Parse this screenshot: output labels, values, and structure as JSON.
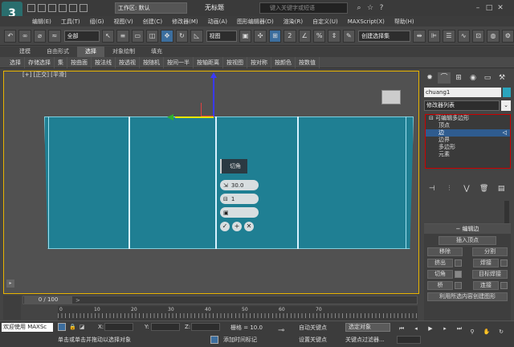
{
  "title_bar": {
    "workspace_label": "工作区: 默认",
    "doc_title": "无标题",
    "search_placeholder": "键入关键字或短语"
  },
  "menu": [
    "编辑(E)",
    "工具(T)",
    "组(G)",
    "视图(V)",
    "创建(C)",
    "修改器(M)",
    "动画(A)",
    "图形编辑器(D)",
    "渲染(R)",
    "自定义(U)",
    "MAXScript(X)",
    "帮助(H)"
  ],
  "toolbar": {
    "selection_filter": "全部",
    "ref_coord": "视图",
    "named_selection": "创建选择集"
  },
  "ribbon": {
    "tabs": [
      "建模",
      "自由形式",
      "选择",
      "对象绘制",
      "填充"
    ],
    "active_tab": "选择",
    "commands": [
      "选择",
      "存储选择",
      "集",
      "按曲面",
      "按法线",
      "按透视",
      "按随机",
      "按间一半",
      "按轴距离",
      "按视图",
      "按对称",
      "按颜色",
      "按数值"
    ]
  },
  "viewport": {
    "label": "[+] [正交] [平滑]",
    "caddy": {
      "title": "切角",
      "amount": "30.0",
      "segments": "1",
      "rows": [
        "30.0",
        "1",
        ""
      ],
      "ok": "✓",
      "apply": "+",
      "cancel": "✕"
    }
  },
  "command_panel": {
    "object_name": "chuang1",
    "object_color": "#2aa5bd",
    "modifier_list": "修改器列表",
    "stack": [
      {
        "label": "可编辑多边形",
        "level": 0,
        "selected": false
      },
      {
        "label": "顶点",
        "level": 1,
        "selected": false
      },
      {
        "label": "边",
        "level": 1,
        "selected": true
      },
      {
        "label": "边界",
        "level": 1,
        "selected": false
      },
      {
        "label": "多边形",
        "level": 1,
        "selected": false
      },
      {
        "label": "元素",
        "level": 1,
        "selected": false
      }
    ],
    "edit_edges": {
      "header": "编辑边",
      "insert_vertex": "插入顶点",
      "remove": "移除",
      "split": "分割",
      "extrude": "挤出",
      "weld": "焊接",
      "chamfer": "切角",
      "target_weld": "目标焊接",
      "bridge": "桥",
      "connect": "连接",
      "create_shape": "利用所选内容创建图形"
    }
  },
  "timeline": {
    "position": "0 / 100",
    "ticks": [
      "0",
      "10",
      "20",
      "30",
      "40",
      "50",
      "60",
      "70"
    ]
  },
  "status": {
    "welcome": "欢迎使用 MAXSc",
    "prompt": "单击或单击并拖动以选择对象",
    "x_label": "X:",
    "y_label": "Y:",
    "z_label": "Z:",
    "grid": "栅格 = 10.0",
    "add_time_tag": "添加时间标记",
    "auto_key": "自动关键点",
    "set_key": "设置关键点",
    "selected": "选定对象",
    "key_filters": "关键点过滤器..."
  },
  "accent_colors": {
    "viewport_border": "#e8b400",
    "mesh": "#1f7f93",
    "selection": "#2f5c8f"
  }
}
